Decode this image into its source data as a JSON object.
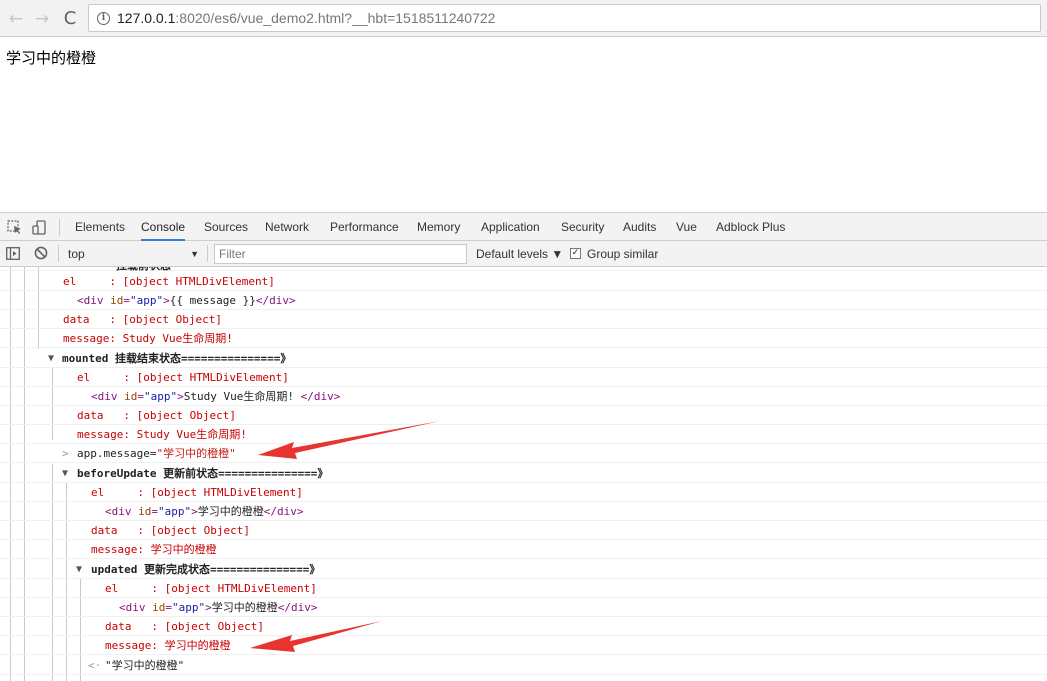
{
  "browser": {
    "back_glyph": "←",
    "forward_glyph": "→",
    "reload_glyph": "C",
    "info_glyph": "i",
    "url_host": "127.0.0.1",
    "url_rest": ":8020/es6/vue_demo2.html?__hbt=1518511240722"
  },
  "page": {
    "text": "学习中的橙橙"
  },
  "devtools": {
    "tabs": [
      "Elements",
      "Console",
      "Sources",
      "Network",
      "Performance",
      "Memory",
      "Application",
      "Security",
      "Audits",
      "Vue",
      "Adblock Plus"
    ],
    "active_tab": "Console",
    "toolbar": {
      "context": "top",
      "context_arrow": "▼",
      "filter_placeholder": "Filter",
      "levels": "Default levels ▼",
      "group_similar": "Group similar",
      "group_checked": "✓"
    },
    "log": {
      "cut_header": "挂载前状态",
      "block1": {
        "el": "el     : [object HTMLDivElement]",
        "html_open": "<div id=\"app\">",
        "html_text": "{{ message }}",
        "html_close": "</div>",
        "data": "data   : [object Object]",
        "message": "message: Study Vue生命周期!"
      },
      "mounted": {
        "toggle": "▼",
        "header": "mounted 挂载结束状态===============》",
        "el": "el     : [object HTMLDivElement]",
        "html_text": "Study Vue生命周期! ",
        "data": "data   : [object Object]",
        "message": "message: Study Vue生命周期!"
      },
      "command": {
        "caret": ">",
        "expr": "app.message=",
        "value": "\"学习中的橙橙\""
      },
      "beforeUpdate": {
        "toggle": "▼",
        "header": "beforeUpdate 更新前状态===============》",
        "el": "el     : [object HTMLDivElement]",
        "html_text": "学习中的橙橙",
        "data": "data   : [object Object]",
        "message": "message: 学习中的橙橙"
      },
      "updated": {
        "toggle": "▼",
        "header": "updated 更新完成状态===============》",
        "el": "el     : [object HTMLDivElement]",
        "html_text": "学习中的橙橙",
        "data": "data   : [object Object]",
        "message": "message: 学习中的橙橙"
      },
      "result": {
        "caret": "<·",
        "value": "\"学习中的橙橙\""
      }
    }
  },
  "colors": {
    "log_red": "#c80000",
    "annotation_arrow": "#e8332e",
    "active_tab_underline": "#3879d9"
  }
}
